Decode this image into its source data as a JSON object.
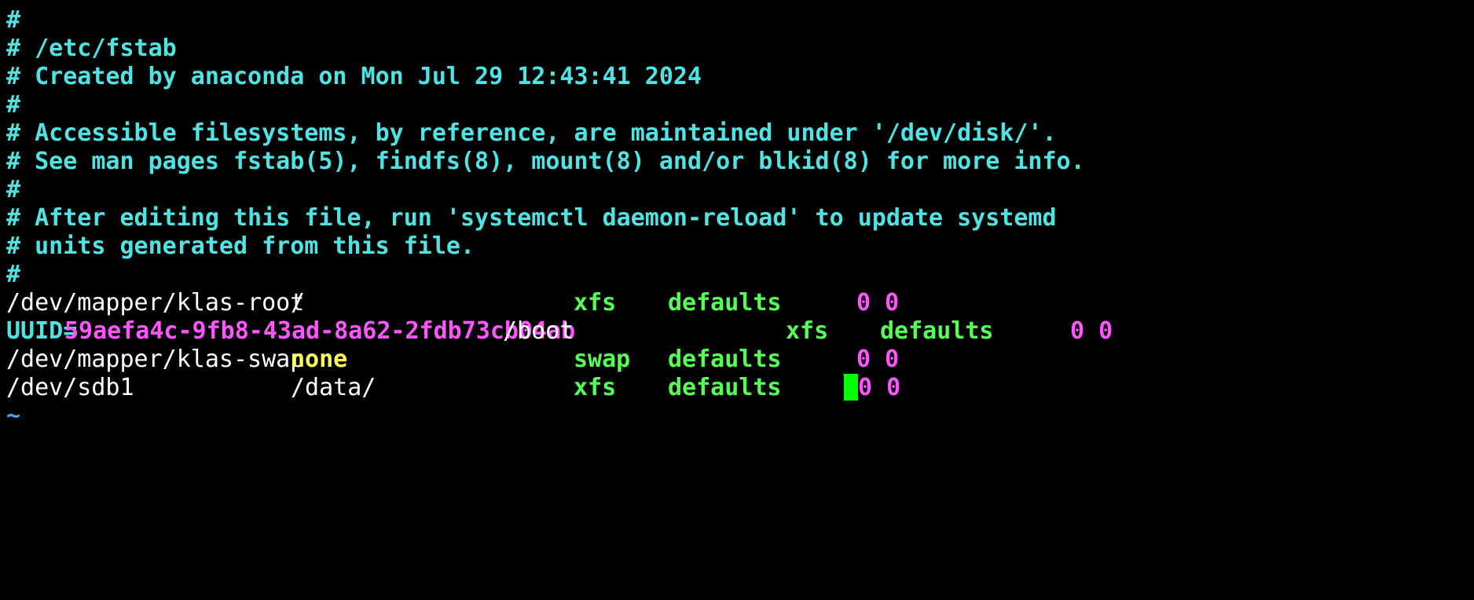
{
  "editor": {
    "comment_lines": [
      "#",
      "# /etc/fstab",
      "# Created by anaconda on Mon Jul 29 12:43:41 2024",
      "#",
      "# Accessible filesystems, by reference, are maintained under '/dev/disk/'.",
      "# See man pages fstab(5), findfs(8), mount(8) and/or blkid(8) for more info.",
      "#",
      "# After editing this file, run 'systemctl daemon-reload' to update systemd",
      "# units generated from this file.",
      "#"
    ],
    "entries": [
      {
        "device": "/dev/mapper/klas-root",
        "mount": "/",
        "fstype": "xfs",
        "options": "defaults",
        "dump_pass": "0 0"
      },
      {
        "device_key": "UUID=",
        "device_value": "59aefa4c-9fb8-43ad-8a62-2fdb73cb04ab",
        "mount": "/boot",
        "fstype": "xfs",
        "options": "defaults",
        "dump_pass": "0 0"
      },
      {
        "device": "/dev/mapper/klas-swap",
        "mount": "none",
        "fstype": "swap",
        "options": "defaults",
        "dump_pass": "0 0"
      },
      {
        "device": "/dev/sdb1",
        "mount": "/data/",
        "fstype": "xfs",
        "options": "defaults",
        "dump_pass": "0 0"
      }
    ],
    "empty_line_marker": "~"
  },
  "colors": {
    "background": "#000000",
    "comment": "#4fe3e3",
    "device": "#ffffff",
    "uuid_value": "#ff55ff",
    "mount_none": "#ffff55",
    "fstype": "#55ff55",
    "numbers": "#ff55ff",
    "cursor": "#00ff00",
    "tilde": "#4fa0ff"
  }
}
